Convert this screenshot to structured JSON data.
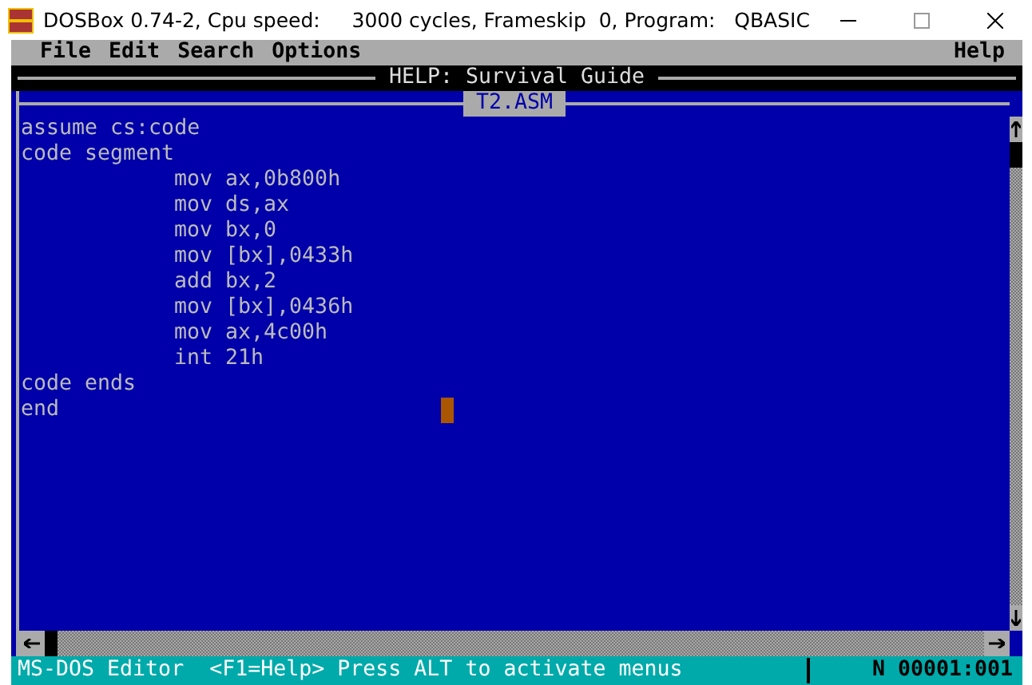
{
  "window": {
    "title": "DOSBox 0.74-2, Cpu speed:     3000 cycles, Frameskip  0, Program:   QBASIC"
  },
  "menu": {
    "items": [
      {
        "label": "File"
      },
      {
        "label": "Edit"
      },
      {
        "label": "Search"
      },
      {
        "label": "Options"
      }
    ],
    "help": "Help"
  },
  "help_window": {
    "title": "HELP: Survival Guide"
  },
  "editor": {
    "title": "T2.ASM",
    "lines": [
      {
        "kind": "directive",
        "text": "assume cs:code"
      },
      {
        "kind": "directive",
        "text": "code segment"
      },
      {
        "kind": "instruction",
        "text": "mov ax,0b800h"
      },
      {
        "kind": "instruction",
        "text": "mov ds,ax"
      },
      {
        "kind": "instruction",
        "text": "mov bx,0"
      },
      {
        "kind": "instruction",
        "text": "mov [bx],0433h"
      },
      {
        "kind": "instruction",
        "text": "add bx,2"
      },
      {
        "kind": "instruction",
        "text": "mov [bx],0436h"
      },
      {
        "kind": "instruction",
        "text": "mov ax,4c00h"
      },
      {
        "kind": "instruction",
        "text": "int 21h"
      },
      {
        "kind": "directive",
        "text": "code ends"
      },
      {
        "kind": "directive",
        "text": "end"
      }
    ]
  },
  "status_bar": {
    "message": "MS-DOS Editor  <F1=Help> Press ALT to activate menus",
    "position": "N 00001:001"
  }
}
